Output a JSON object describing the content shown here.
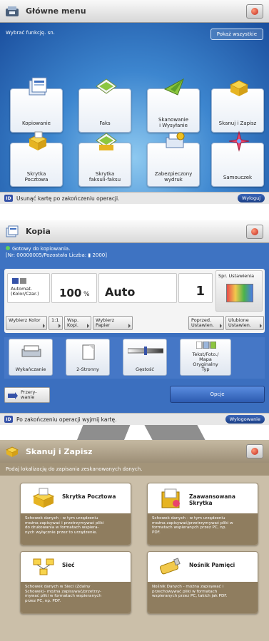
{
  "main_menu": {
    "title": "Główne menu",
    "prompt": "Wybrać funkcję. sn.",
    "show_all": "Pokaż wszystkie",
    "tiles": [
      {
        "label": "Kopiowanie",
        "icon": "copy-icon"
      },
      {
        "label": "Faks",
        "icon": "fax-icon"
      },
      {
        "label": "Skanowanie\ni Wysyłanie",
        "icon": "scan-send-icon"
      },
      {
        "label": "Skanuj i Zapisz",
        "icon": "scan-store-icon"
      },
      {
        "label": "Skrytka\nPocztowa",
        "icon": "mailbox-icon"
      },
      {
        "label": "Skrytka\nfaksuli-faksu",
        "icon": "fax-box-icon"
      },
      {
        "label": "Zabezpieczony\nwydruk",
        "icon": "secure-print-icon"
      },
      {
        "label": "Samouczek",
        "icon": "tutorial-icon"
      }
    ],
    "status": "Usunąć kartę po zakończeniu operacji.",
    "logout": "Wyloguj"
  },
  "copy": {
    "title": "Kopia",
    "info_line1": "Gotowy do kopiowania.",
    "info_line2": "[Nr: 00000005/Pozostała Liczba: ▮ 2000]",
    "color_mode": "Automat.\n(Kolor/Czar.)",
    "zoom_value": "100",
    "zoom_unit": "%",
    "paper": "Auto",
    "copies": "1",
    "settings_check": "Spr. Ustawienia",
    "buttons_row": [
      {
        "label": "Wybierz Kolor"
      },
      {
        "label": "1:1"
      },
      {
        "label": "Wsp.\nKopi."
      },
      {
        "label": "Wybierz\nPapier"
      },
      {
        "label": "Poprzed.\nUstawien."
      },
      {
        "label": "Ulubione\nUstawien."
      }
    ],
    "functions": [
      {
        "label": "Wykańczanie",
        "icon": "finishing-icon"
      },
      {
        "label": "2-Stronny",
        "icon": "two-sided-icon"
      },
      {
        "label": "Gęstość",
        "icon": "density-icon"
      },
      {
        "label": "Tekst/Foto./\nMapa\nOryginalny\nTyp",
        "icon": "original-type-icon"
      }
    ],
    "interrupt": "Przery-\nwanie",
    "options": "Opcje",
    "status": "Po zakończeniu operacji wyjmij kartę.",
    "logout": "Wylogowanie"
  },
  "scan_store": {
    "title": "Skanuj i Zapisz",
    "instruction": "Podaj lokalizację do zapisania zeskanowanych danych.",
    "cards": [
      {
        "title": "Skrytka Pocztowa",
        "icon": "mailbox-icon",
        "desc": "Schowek danych - w tym urządzeniu\nmożna zapisywać i przetrzymywać pliki\ndo drukowania w formatach wspiera-\nnych wyłącznie przez to urządzenie."
      },
      {
        "title": "Zaawansowana Skrytka",
        "icon": "advanced-box-icon",
        "desc": "Schowek danych - w tym urządzeniu\nmożna zapisywać/przetrzymywać pliki w\nformatach wspieranych przez PC, np.\nPDF."
      },
      {
        "title": "Sieć",
        "icon": "network-icon",
        "desc": "Schowek danych w Sieci (Zdalny\nSchowek)- można zapisywać/przetrzy-\nmywać pliki w formatach wspieranych\nprzez PC, np. PDF."
      },
      {
        "title": "Nośnik Pamięci",
        "icon": "memory-media-icon",
        "desc": "Nośnik Danych - można zapisywać i\nprzechowywać pliki w formatach\nwspieranych przez PC, takich jak PDF."
      }
    ]
  }
}
